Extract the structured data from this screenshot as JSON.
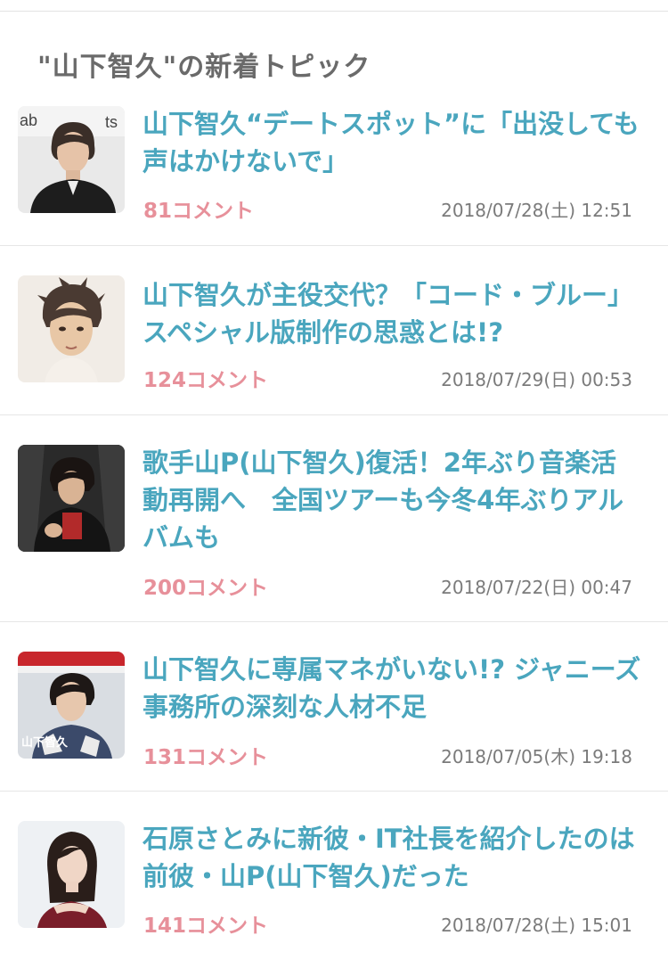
{
  "section": {
    "title": "\"山下智久\"の新着トピック"
  },
  "topics": [
    {
      "title": "山下智久“デートスポット”に「出没しても声はかけないで」",
      "comments": "81コメント",
      "date": "2018/07/28(土) 12:51",
      "thumb_icon": "person-photo-icon"
    },
    {
      "title": "山下智久が主役交代？「コード・ブルー」スペシャル版制作の思惑とは!?",
      "comments": "124コメント",
      "date": "2018/07/29(日) 00:53",
      "thumb_icon": "person-illustration-icon"
    },
    {
      "title": "歌手山P(山下智久)復活！2年ぶり音楽活動再開へ　全国ツアーも今冬4年ぶりアルバムも",
      "comments": "200コメント",
      "date": "2018/07/22(日) 00:47",
      "thumb_icon": "person-photo-icon"
    },
    {
      "title": "山下智久に専属マネがいない!? ジャニーズ事務所の深刻な人材不足",
      "comments": "131コメント",
      "date": "2018/07/05(木) 19:18",
      "thumb_icon": "magazine-cover-icon"
    },
    {
      "title": "石原さとみに新彼・IT社長を紹介したのは前彼・山P(山下智久)だった",
      "comments": "141コメント",
      "date": "2018/07/28(土) 15:01",
      "thumb_icon": "person-photo-icon"
    }
  ],
  "thumb_caption": "山下智久",
  "colors": {
    "title_text": "#4aa6be",
    "comment_text": "#e7909a",
    "date_text": "#7b7b7b",
    "heading_text": "#6a6a6a"
  }
}
